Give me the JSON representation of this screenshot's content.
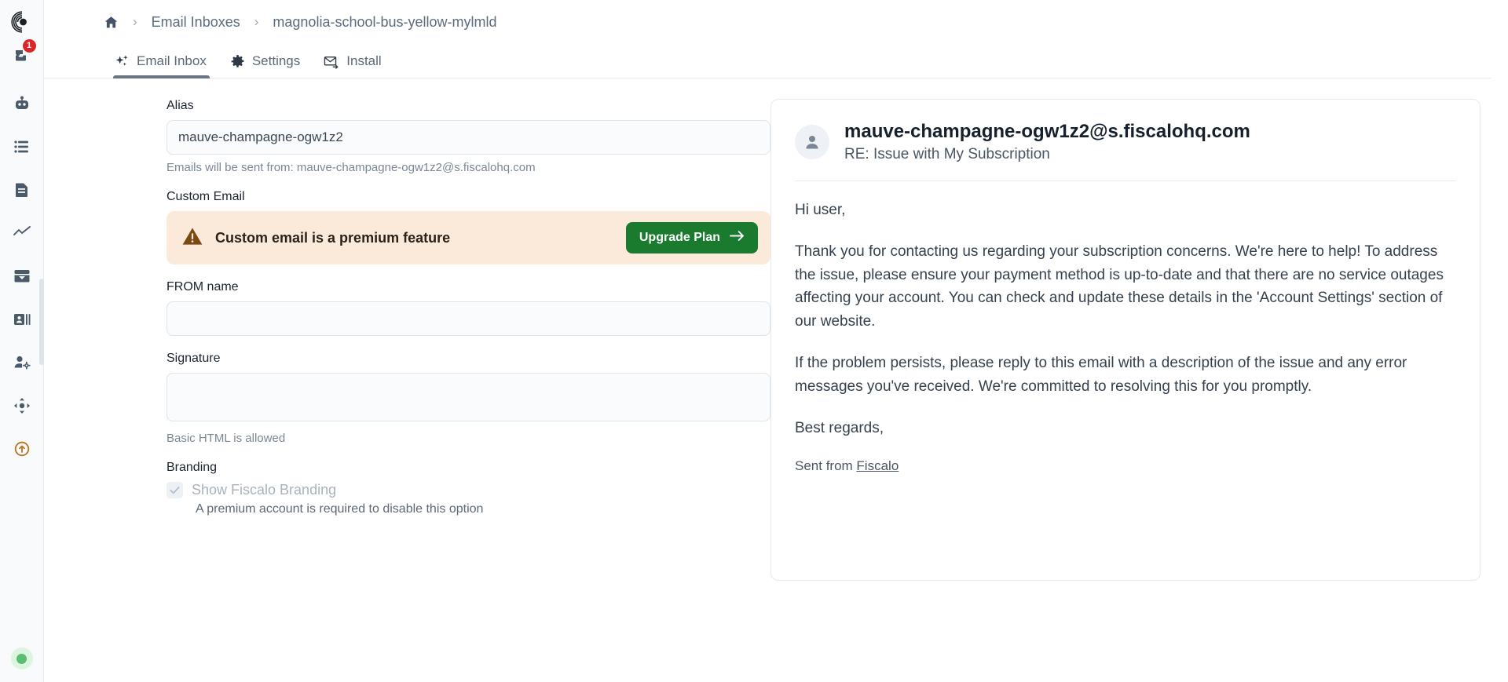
{
  "sidebar": {
    "logo_icon": "spiral-logo-icon",
    "items": [
      {
        "icon": "inbox-unread-icon",
        "badge": "1"
      },
      {
        "icon": "robot-icon",
        "badge": null
      },
      {
        "icon": "server-list-icon",
        "badge": null
      },
      {
        "icon": "document-icon",
        "badge": null
      },
      {
        "icon": "analytics-line-icon",
        "badge": null
      },
      {
        "icon": "inbox-tray-icon",
        "badge": null
      },
      {
        "icon": "contact-card-icon",
        "badge": null
      },
      {
        "icon": "user-settings-icon",
        "badge": null
      },
      {
        "icon": "move-arrows-icon",
        "badge": null
      },
      {
        "icon": "upload-circle-icon",
        "badge": null
      }
    ],
    "status_indicator": "online-status-dot"
  },
  "breadcrumb": {
    "home_icon": "home-icon",
    "separator": "›",
    "parent": "Email Inboxes",
    "current": "magnolia-school-bus-yellow-mylmld"
  },
  "tabs": [
    {
      "label": "Email Inbox",
      "icon": "sparkles-icon",
      "active": true
    },
    {
      "label": "Settings",
      "icon": "gear-icon",
      "active": false
    },
    {
      "label": "Install",
      "icon": "envelope-arrow-icon",
      "active": false
    }
  ],
  "form": {
    "alias": {
      "label": "Alias",
      "value": "mauve-champagne-ogw1z2",
      "placeholder": "",
      "hint": "Emails will be sent from: mauve-champagne-ogw1z2@s.fiscalohq.com"
    },
    "custom_email": {
      "label": "Custom Email",
      "banner_icon": "warning-triangle-icon",
      "banner_text": "Custom email is a premium feature",
      "button_label": "Upgrade Plan",
      "button_icon": "arrow-right-icon",
      "banner_bg": "#fbeada",
      "button_bg": "#1a7a2e"
    },
    "from_name": {
      "label": "FROM name",
      "value": "",
      "placeholder": ""
    },
    "signature": {
      "label": "Signature",
      "value": "",
      "placeholder": "",
      "hint": "Basic HTML is allowed"
    },
    "branding": {
      "label": "Branding",
      "checkbox_icon": "check-icon",
      "checkbox_label": "Show Fiscalo Branding",
      "checked": true,
      "disabled": true,
      "sub": "A premium account is required to disable this option"
    }
  },
  "preview": {
    "avatar_icon": "person-avatar-icon",
    "from": "mauve-champagne-ogw1z2@s.fiscalohq.com",
    "subject": "RE: Issue with My Subscription",
    "paragraphs": [
      "Hi user,",
      "Thank you for contacting us regarding your subscription concerns. We're here to help! To address the issue, please ensure your payment method is up-to-date and that there are no service outages affecting your account. You can check and update these details in the 'Account Settings' section of our website.",
      "If the problem persists, please reply to this email with a description of the issue and any error messages you've received. We're committed to resolving this for you promptly.",
      "Best regards,"
    ],
    "sent_from_prefix": "Sent from ",
    "sent_from_link": "Fiscalo"
  }
}
